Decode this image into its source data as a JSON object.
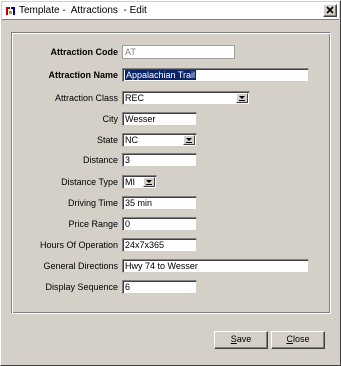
{
  "window": {
    "title": "Template -  Attractions  - Edit"
  },
  "form": {
    "attraction_code": {
      "label": "Attraction Code",
      "value": "AT"
    },
    "attraction_name": {
      "label": "Attraction Name",
      "value": "Appalachian Trail"
    },
    "attraction_class": {
      "label": "Attraction Class",
      "value": "REC"
    },
    "city": {
      "label": "City",
      "value": "Wesser"
    },
    "state": {
      "label": "State",
      "value": "NC"
    },
    "distance": {
      "label": "Distance",
      "value": "3"
    },
    "distance_type": {
      "label": "Distance Type",
      "value": "MI"
    },
    "driving_time": {
      "label": "Driving Time",
      "value": "35 min"
    },
    "price_range": {
      "label": "Price Range",
      "value": "0"
    },
    "hours_of_operation": {
      "label": "Hours Of Operation",
      "value": "24x7x365"
    },
    "general_directions": {
      "label": "General Directions",
      "value": "Hwy 74 to Wesser"
    },
    "display_sequence": {
      "label": "Display Sequence",
      "value": "6"
    }
  },
  "buttons": {
    "save_first": "S",
    "save_rest": "ave",
    "close_first": "C",
    "close_rest": "lose"
  }
}
